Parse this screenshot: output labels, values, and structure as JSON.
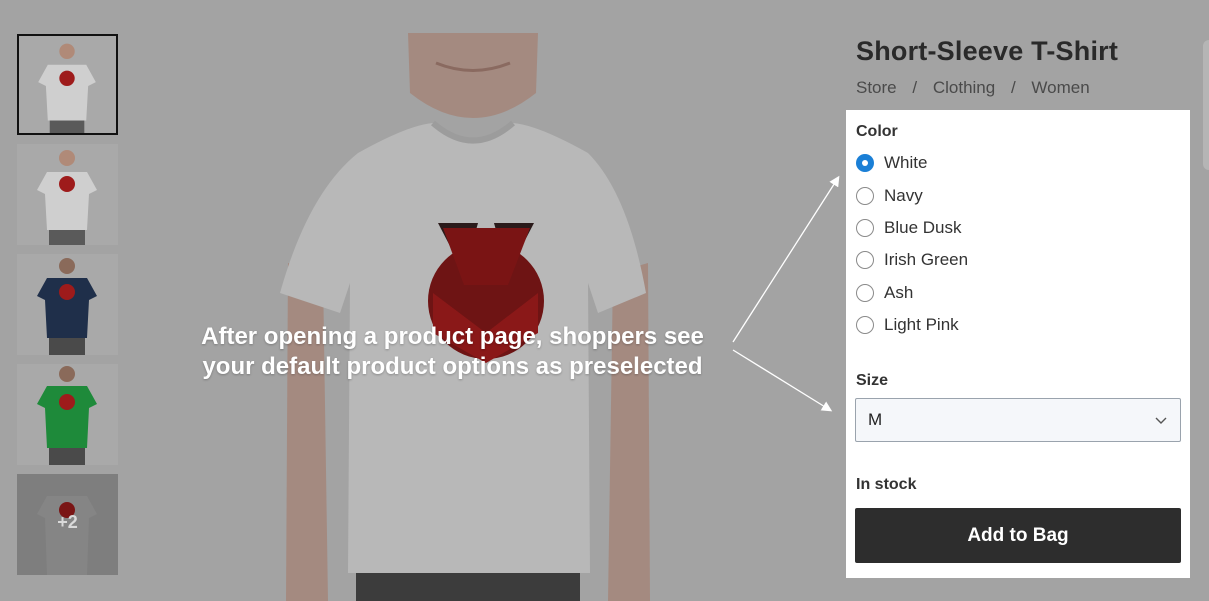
{
  "product": {
    "title": "Short-Sleeve T-Shirt",
    "breadcrumb": [
      "Store",
      "Clothing",
      "Women"
    ],
    "breadcrumb_separator": "/"
  },
  "thumbnails": [
    {
      "shirt_color": "#cfcfcf",
      "selected": true
    },
    {
      "shirt_color": "#cfcfcf",
      "selected": false
    },
    {
      "shirt_color": "#1f2f4a",
      "selected": false
    },
    {
      "shirt_color": "#1e8a3a",
      "selected": false
    },
    {
      "shirt_color": "#7a7a7a",
      "more_label": "+2"
    }
  ],
  "callout": {
    "text": "After opening a product page, shoppers see your default product options as preselected"
  },
  "color_option": {
    "label": "Color",
    "selected": "White",
    "options": [
      "White",
      "Navy",
      "Blue Dusk",
      "Irish Green",
      "Ash",
      "Light Pink"
    ]
  },
  "size_option": {
    "label": "Size",
    "value": "M"
  },
  "stock_status": "In stock",
  "add_to_bag_label": "Add to Bag",
  "colors": {
    "radio_checked": "#1a7fd6",
    "button_bg": "#2d2d2d",
    "overlay": "#a3a3a3"
  },
  "icons": {
    "select_chevron": "chevron-down-icon",
    "logo": "fox-logo"
  }
}
